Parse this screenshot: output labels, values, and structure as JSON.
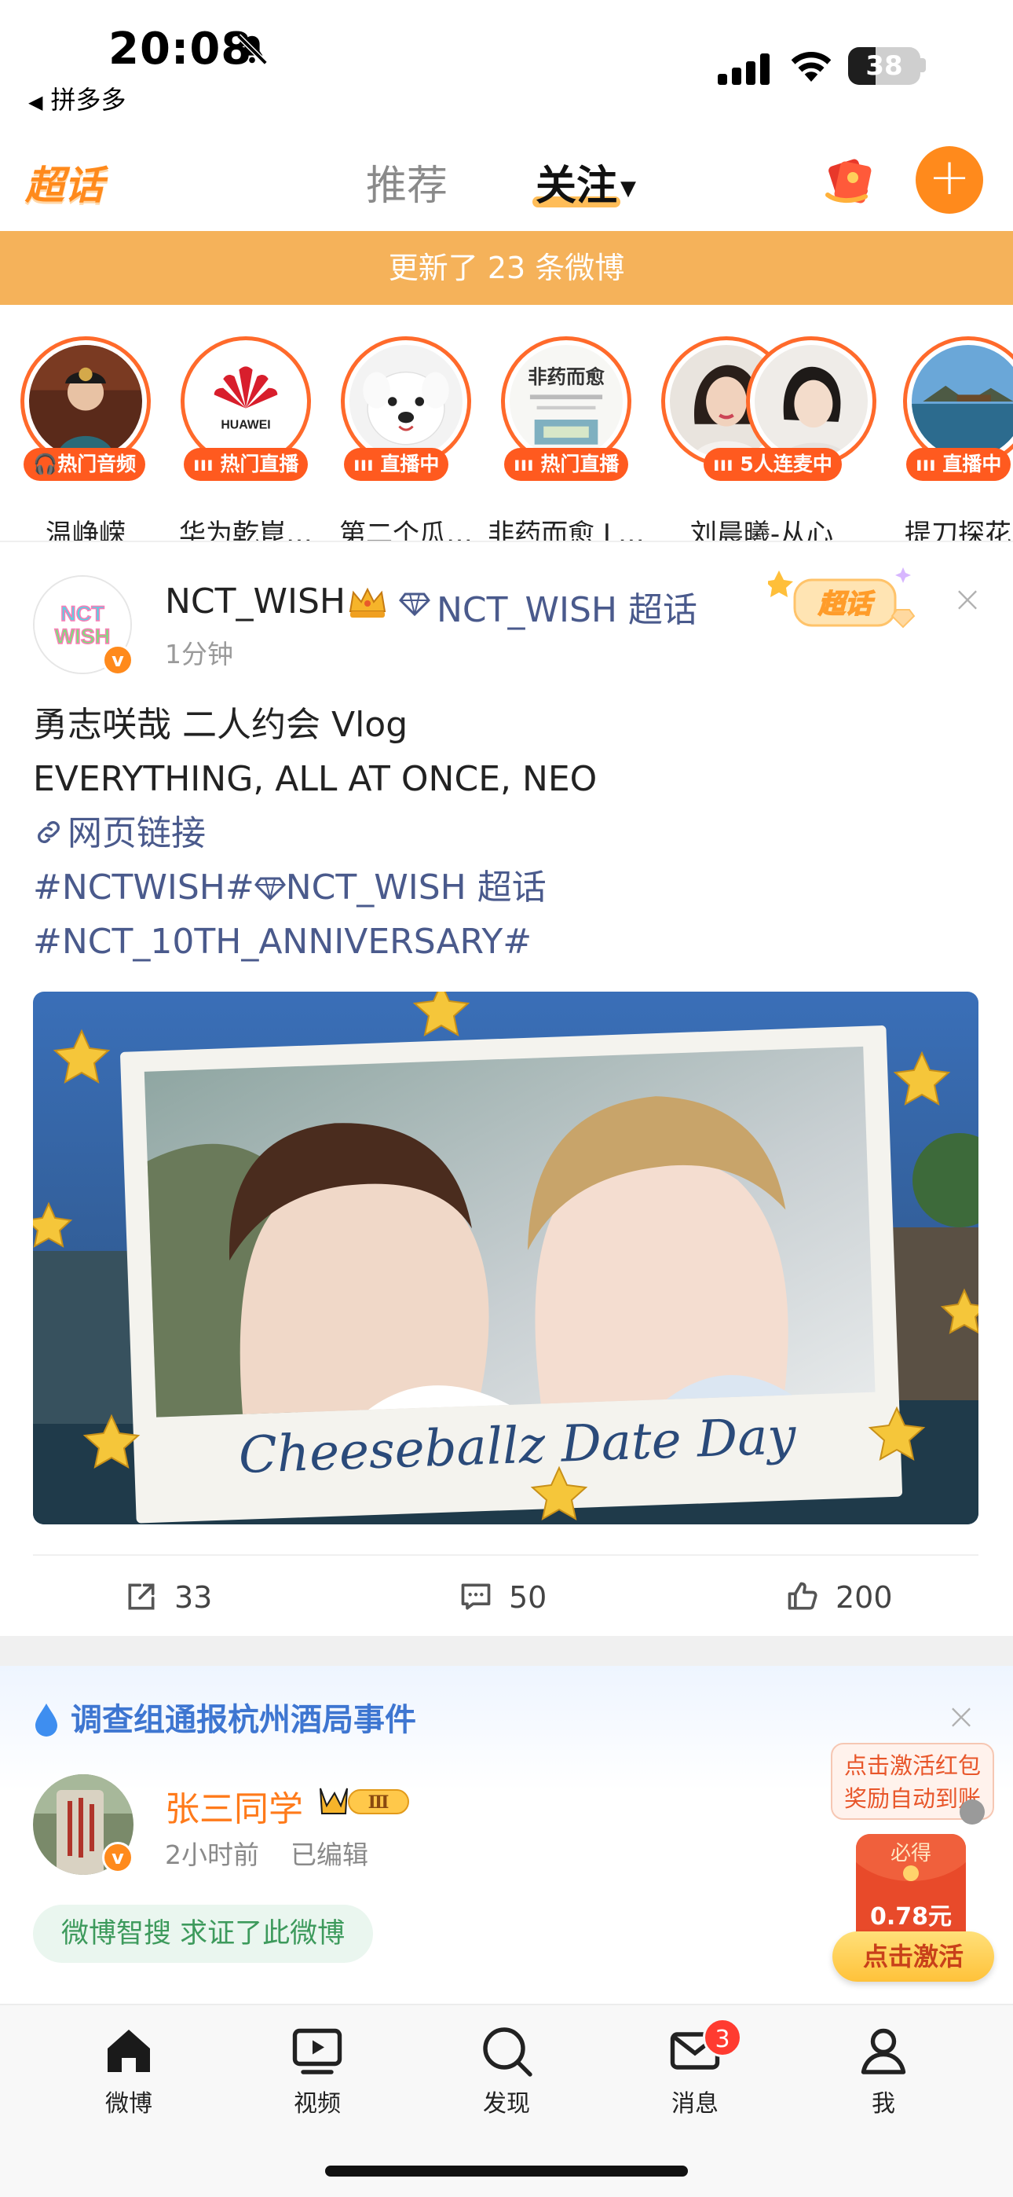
{
  "status_bar": {
    "time": "20:08",
    "back_app": "拼多多",
    "battery_level": "38",
    "battery_fraction": 0.38
  },
  "top_nav": {
    "logo": "超话",
    "tabs": [
      "推荐",
      "关注"
    ],
    "active_tab": "关注"
  },
  "update_banner": "更新了 23 条微博",
  "stories": [
    {
      "name": "温峥嵘",
      "badge": "热门音频",
      "badge_icon": "headphones-icon"
    },
    {
      "name": "华为乾崑…",
      "badge": "热门直播",
      "badge_icon": "live-bars-icon",
      "logo_text": "HUAWEI"
    },
    {
      "name": "第二个瓜…",
      "badge": "直播中",
      "badge_icon": "live-bars-icon"
    },
    {
      "name": "非药而愈 L…",
      "badge": "热门直播",
      "badge_icon": "live-bars-icon",
      "cover_text": "非药而愈"
    },
    {
      "name": "刘晨曦-从心",
      "badge": "5人连麦中",
      "badge_icon": "live-bars-icon"
    },
    {
      "name": "提刀探花",
      "badge": "直播中",
      "badge_icon": "live-bars-icon"
    }
  ],
  "post1": {
    "username": "NCT_WISH",
    "supertopic": "NCT_WISH 超话",
    "time": "1分钟",
    "avatar_text": "NCT WISH",
    "sticker": "超话",
    "lines": {
      "l1": "勇志咲哉 二人约会 Vlog",
      "l2": "EVERYTHING, ALL AT ONCE, NEO",
      "l3": "网页链接",
      "l4a": "#NCTWISH#",
      "l4b": "NCT_WISH 超话",
      "l5": "#NCT_10TH_ANNIVERSARY#"
    },
    "image_caption": "Cheeseballz Date Day",
    "actions": {
      "repost": "33",
      "comment": "50",
      "like": "200"
    }
  },
  "post2": {
    "topic": "调查组通报杭州酒局事件",
    "username": "张三同学",
    "vip_level": "Ⅲ",
    "time": "2小时前",
    "edited": "已编辑",
    "ai_verify": "微博智搜 求证了此微博"
  },
  "promo": {
    "tooltip_line1": "点击激活红包",
    "tooltip_line2": "奖励自动到账",
    "envelope_label": "必得",
    "amount": "0.78元",
    "activate": "点击激活"
  },
  "tab_bar": {
    "items": [
      {
        "label": "微博",
        "icon": "home-icon"
      },
      {
        "label": "视频",
        "icon": "video-icon"
      },
      {
        "label": "发现",
        "icon": "search-icon"
      },
      {
        "label": "消息",
        "icon": "mail-icon",
        "badge": "3"
      },
      {
        "label": "我",
        "icon": "profile-icon"
      }
    ]
  },
  "colors": {
    "accent_orange": "#ff8a1c",
    "banner_orange": "#f5b25a",
    "live_badge": "#ff5a1f",
    "link_blue": "#4a5a8c",
    "topic_blue": "#3e76d1",
    "ai_green": "#3d9a5c"
  }
}
